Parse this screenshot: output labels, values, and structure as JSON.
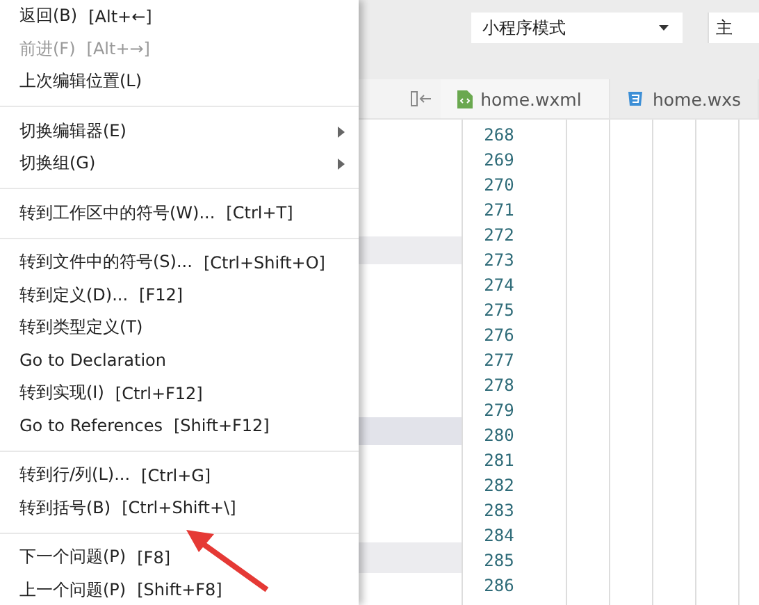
{
  "menu": {
    "groups": [
      [
        {
          "label": "返回(B)",
          "shortcut": "[Alt+←]",
          "disabled": false,
          "submenu": false
        },
        {
          "label": "前进(F)",
          "shortcut": "[Alt+→]",
          "disabled": true,
          "submenu": false
        },
        {
          "label": "上次编辑位置(L)",
          "disabled": false,
          "submenu": false
        }
      ],
      [
        {
          "label": "切换编辑器(E)",
          "disabled": false,
          "submenu": true
        },
        {
          "label": "切换组(G)",
          "disabled": false,
          "submenu": true
        }
      ],
      [
        {
          "label": "转到工作区中的符号(W)...",
          "shortcut": "[Ctrl+T]",
          "disabled": false,
          "submenu": false
        }
      ],
      [
        {
          "label": "转到文件中的符号(S)...",
          "shortcut": "[Ctrl+Shift+O]",
          "disabled": false,
          "submenu": false
        },
        {
          "label": "转到定义(D)...",
          "shortcut": "[F12]",
          "disabled": false,
          "submenu": false
        },
        {
          "label": "转到类型定义(T)",
          "disabled": false,
          "submenu": false
        },
        {
          "label": "Go to Declaration",
          "disabled": false,
          "submenu": false
        },
        {
          "label": "转到实现(I)",
          "shortcut": "[Ctrl+F12]",
          "disabled": false,
          "submenu": false
        },
        {
          "label": "Go to References",
          "shortcut": "[Shift+F12]",
          "disabled": false,
          "submenu": false
        }
      ],
      [
        {
          "label": "转到行/列(L)...",
          "shortcut": "[Ctrl+G]",
          "disabled": false,
          "submenu": false
        },
        {
          "label": "转到括号(B)",
          "shortcut": "[Ctrl+Shift+\\]",
          "disabled": false,
          "submenu": false
        }
      ],
      [
        {
          "label": "下一个问题(P)",
          "shortcut": "[F8]",
          "disabled": false,
          "submenu": false
        },
        {
          "label": "上一个问题(P)",
          "shortcut": "[Shift+F8]",
          "disabled": false,
          "submenu": false
        }
      ]
    ]
  },
  "toolbar": {
    "mode_dropdown": {
      "value": "小程序模式"
    },
    "second_dropdown": {
      "value": "主"
    }
  },
  "tabs": [
    {
      "label": "home.wxml",
      "kind": "wxml",
      "selected": true
    },
    {
      "label": "home.wxs",
      "kind": "css",
      "selected": false
    }
  ],
  "editor": {
    "line_numbers": [
      "268",
      "269",
      "270",
      "271",
      "272",
      "273",
      "274",
      "275",
      "276",
      "277",
      "278",
      "279",
      "280",
      "281",
      "282",
      "283",
      "284",
      "285",
      "286"
    ]
  }
}
